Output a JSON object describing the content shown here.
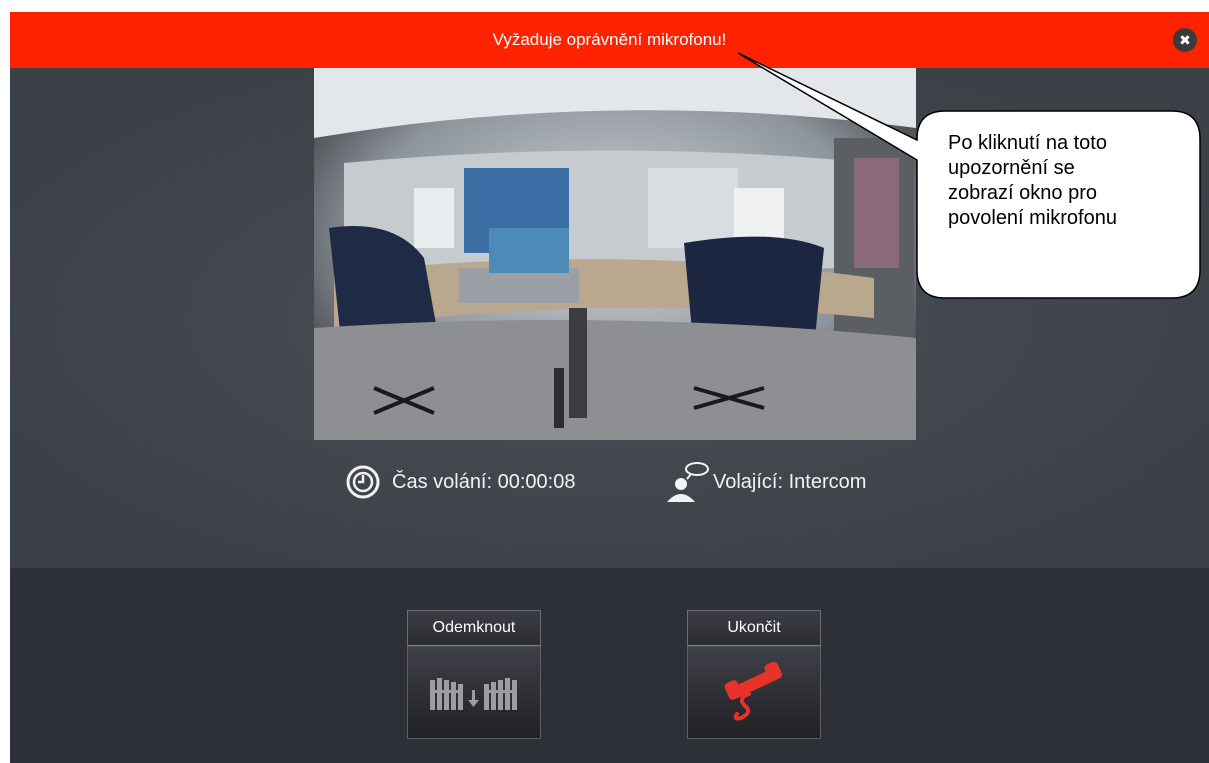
{
  "warning": {
    "text": "Vyžaduje oprávnění mikrofonu!",
    "close_icon": "close-icon"
  },
  "call": {
    "duration_label": "Čas volání: 00:00:08",
    "caller_label": "Volající: Intercom"
  },
  "actions": {
    "unlock_label": "Odemknout",
    "hangup_label": "Ukončit"
  },
  "callout": {
    "lines": [
      "Po kliknutí na toto",
      "upozornění se",
      "zobrazí okno pro",
      "povolení mikrofonu"
    ]
  },
  "colors": {
    "warning_bg": "#ff2200",
    "app_bg": "#3f434a",
    "bottom_bg": "#2d3036",
    "hangup_red": "#e8322a"
  }
}
